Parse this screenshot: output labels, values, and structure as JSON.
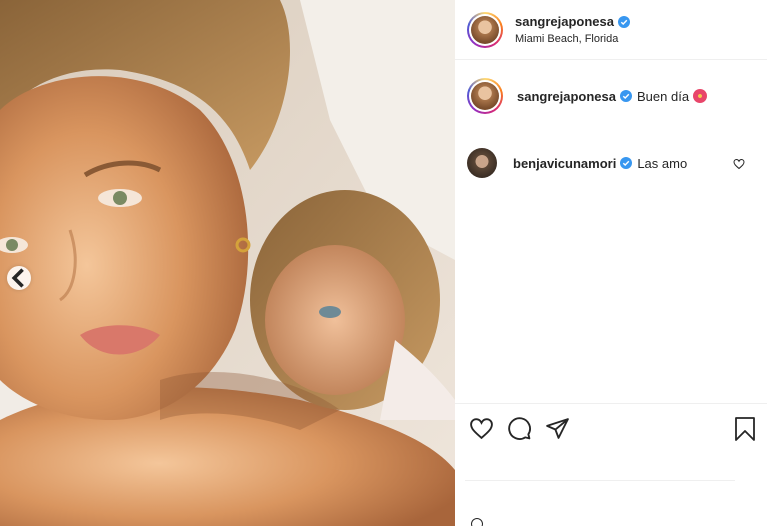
{
  "post": {
    "author": "sangrejaponesa",
    "location": "Miami Beach, Florida"
  },
  "comments": [
    {
      "username": "sangrejaponesa",
      "text": "Buen día",
      "emoji": "hibiscus-emoji"
    },
    {
      "username": "benjavicunamori",
      "text": "Las amo"
    }
  ],
  "icons": {
    "verified": "verified-badge-icon",
    "carousel_prev": "chevron-left-icon",
    "like": "heart-icon",
    "comment": "comment-icon",
    "share": "paper-plane-icon",
    "save": "bookmark-icon"
  },
  "colors": {
    "verified_blue": "#3897f0",
    "border": "#efefef",
    "text": "#262626"
  }
}
